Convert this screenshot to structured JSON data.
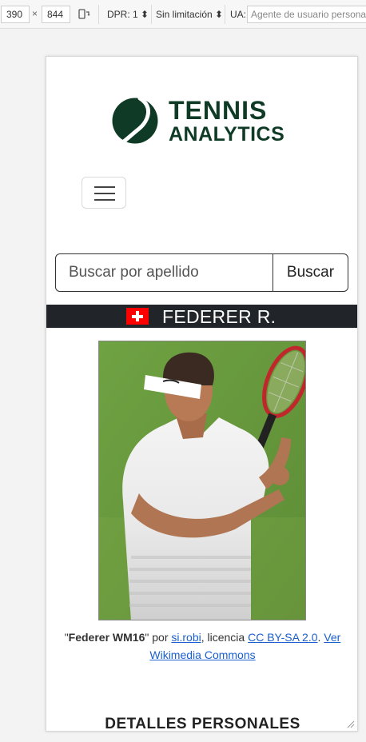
{
  "devtools": {
    "width": "390",
    "times": "×",
    "height": "844",
    "dpr": "DPR: 1 ⬍",
    "throttle": "Sin limitación ⬍",
    "ua_label": "UA:",
    "ua_placeholder": "Agente de usuario personal"
  },
  "logo": {
    "line1": "TENNIS",
    "line2": "ANALYTICS",
    "color": "#0f3b26"
  },
  "search": {
    "placeholder": "Buscar por apellido",
    "value": "",
    "button": "Buscar"
  },
  "player": {
    "name": "FEDERER R.",
    "flag": "switzerland-flag"
  },
  "photo": {
    "alt": "Federer WM16"
  },
  "credit": {
    "quote_open": "\"",
    "title": "Federer WM16",
    "quote_close": "\"",
    "by": " por ",
    "author": "si.robi",
    "license_text": ", licencia ",
    "license": "CC BY-SA 2.0",
    "dot": ". ",
    "commons": "Ver Wikimedia Commons"
  },
  "section": {
    "title": "DETALLES PERSONALES"
  }
}
